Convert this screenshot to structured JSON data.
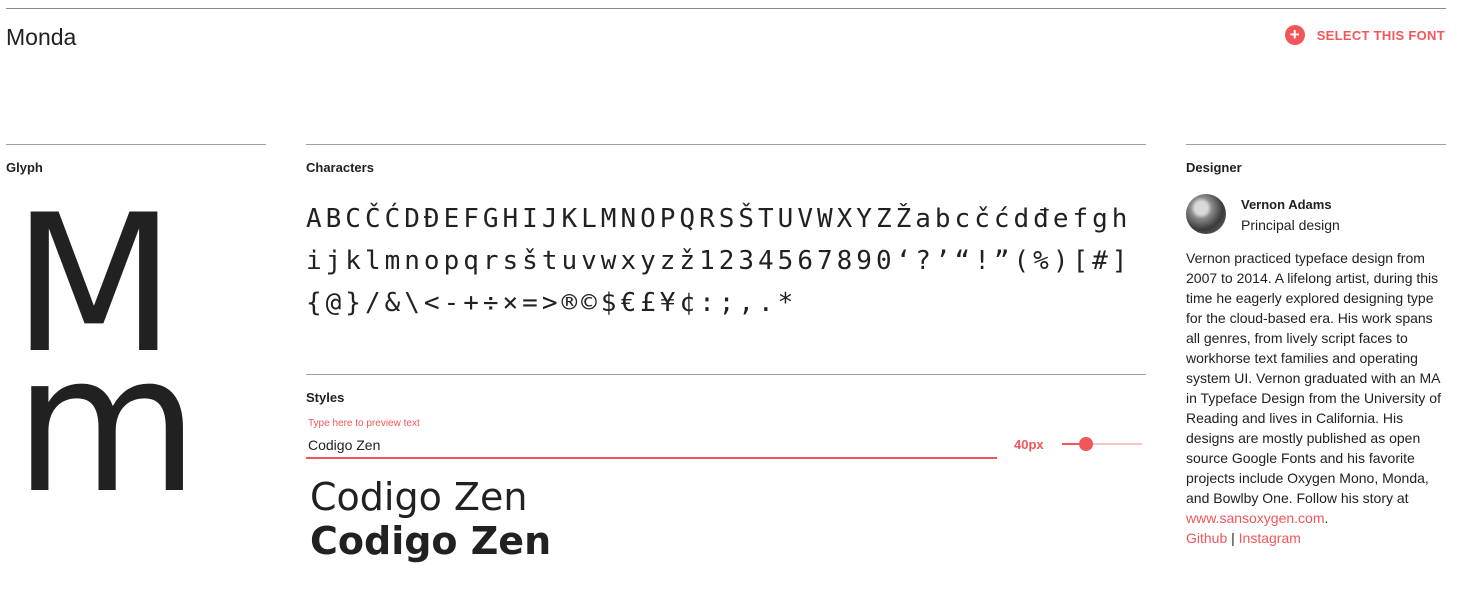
{
  "font": {
    "name": "Monda"
  },
  "actions": {
    "select_label": "SELECT THIS FONT",
    "select_icon": "plus-circle-icon"
  },
  "glyph": {
    "title": "Glyph",
    "upper": "M",
    "lower": "m"
  },
  "characters": {
    "title": "Characters",
    "text": "ABCČĆDĐEFGHIJKLMNOPQRSŠTUVWXYZŽabcčćdđefghijklmnopqrsštuvwxyzž1234567890‘?’“!”(%)[#]{@}/&\\<-+÷×=>®©$€£¥¢:;,.*"
  },
  "styles": {
    "title": "Styles",
    "preview_label": "Type here to preview text",
    "preview_value": "Codigo Zen",
    "size": "40px",
    "slider_fraction": 0.3,
    "samples": [
      {
        "text": "Codigo Zen",
        "weight": "Regular"
      },
      {
        "text": "Codigo Zen",
        "weight": "Bold"
      }
    ]
  },
  "designer": {
    "title": "Designer",
    "name": "Vernon Adams",
    "role": "Principal design",
    "bio": "Vernon practiced typeface design from 2007 to 2014. A lifelong artist, during this time he eagerly explored designing type for the cloud-based era. His work spans all genres, from lively script faces to workhorse text families and operating system UI. Vernon graduated with an MA in Typeface Design from the University of Reading and lives in California. His designs are mostly published as open source Google Fonts and his favorite projects include Oxygen Mono, Monda, and Bowlby One. Follow his story at",
    "website": "www.sansoxygen.com",
    "website_suffix": ".",
    "links": [
      "Github",
      "Instagram"
    ],
    "link_separator": " | "
  },
  "colors": {
    "accent": "#f2565a",
    "text": "#212121",
    "rule": "#9e9e9e"
  }
}
